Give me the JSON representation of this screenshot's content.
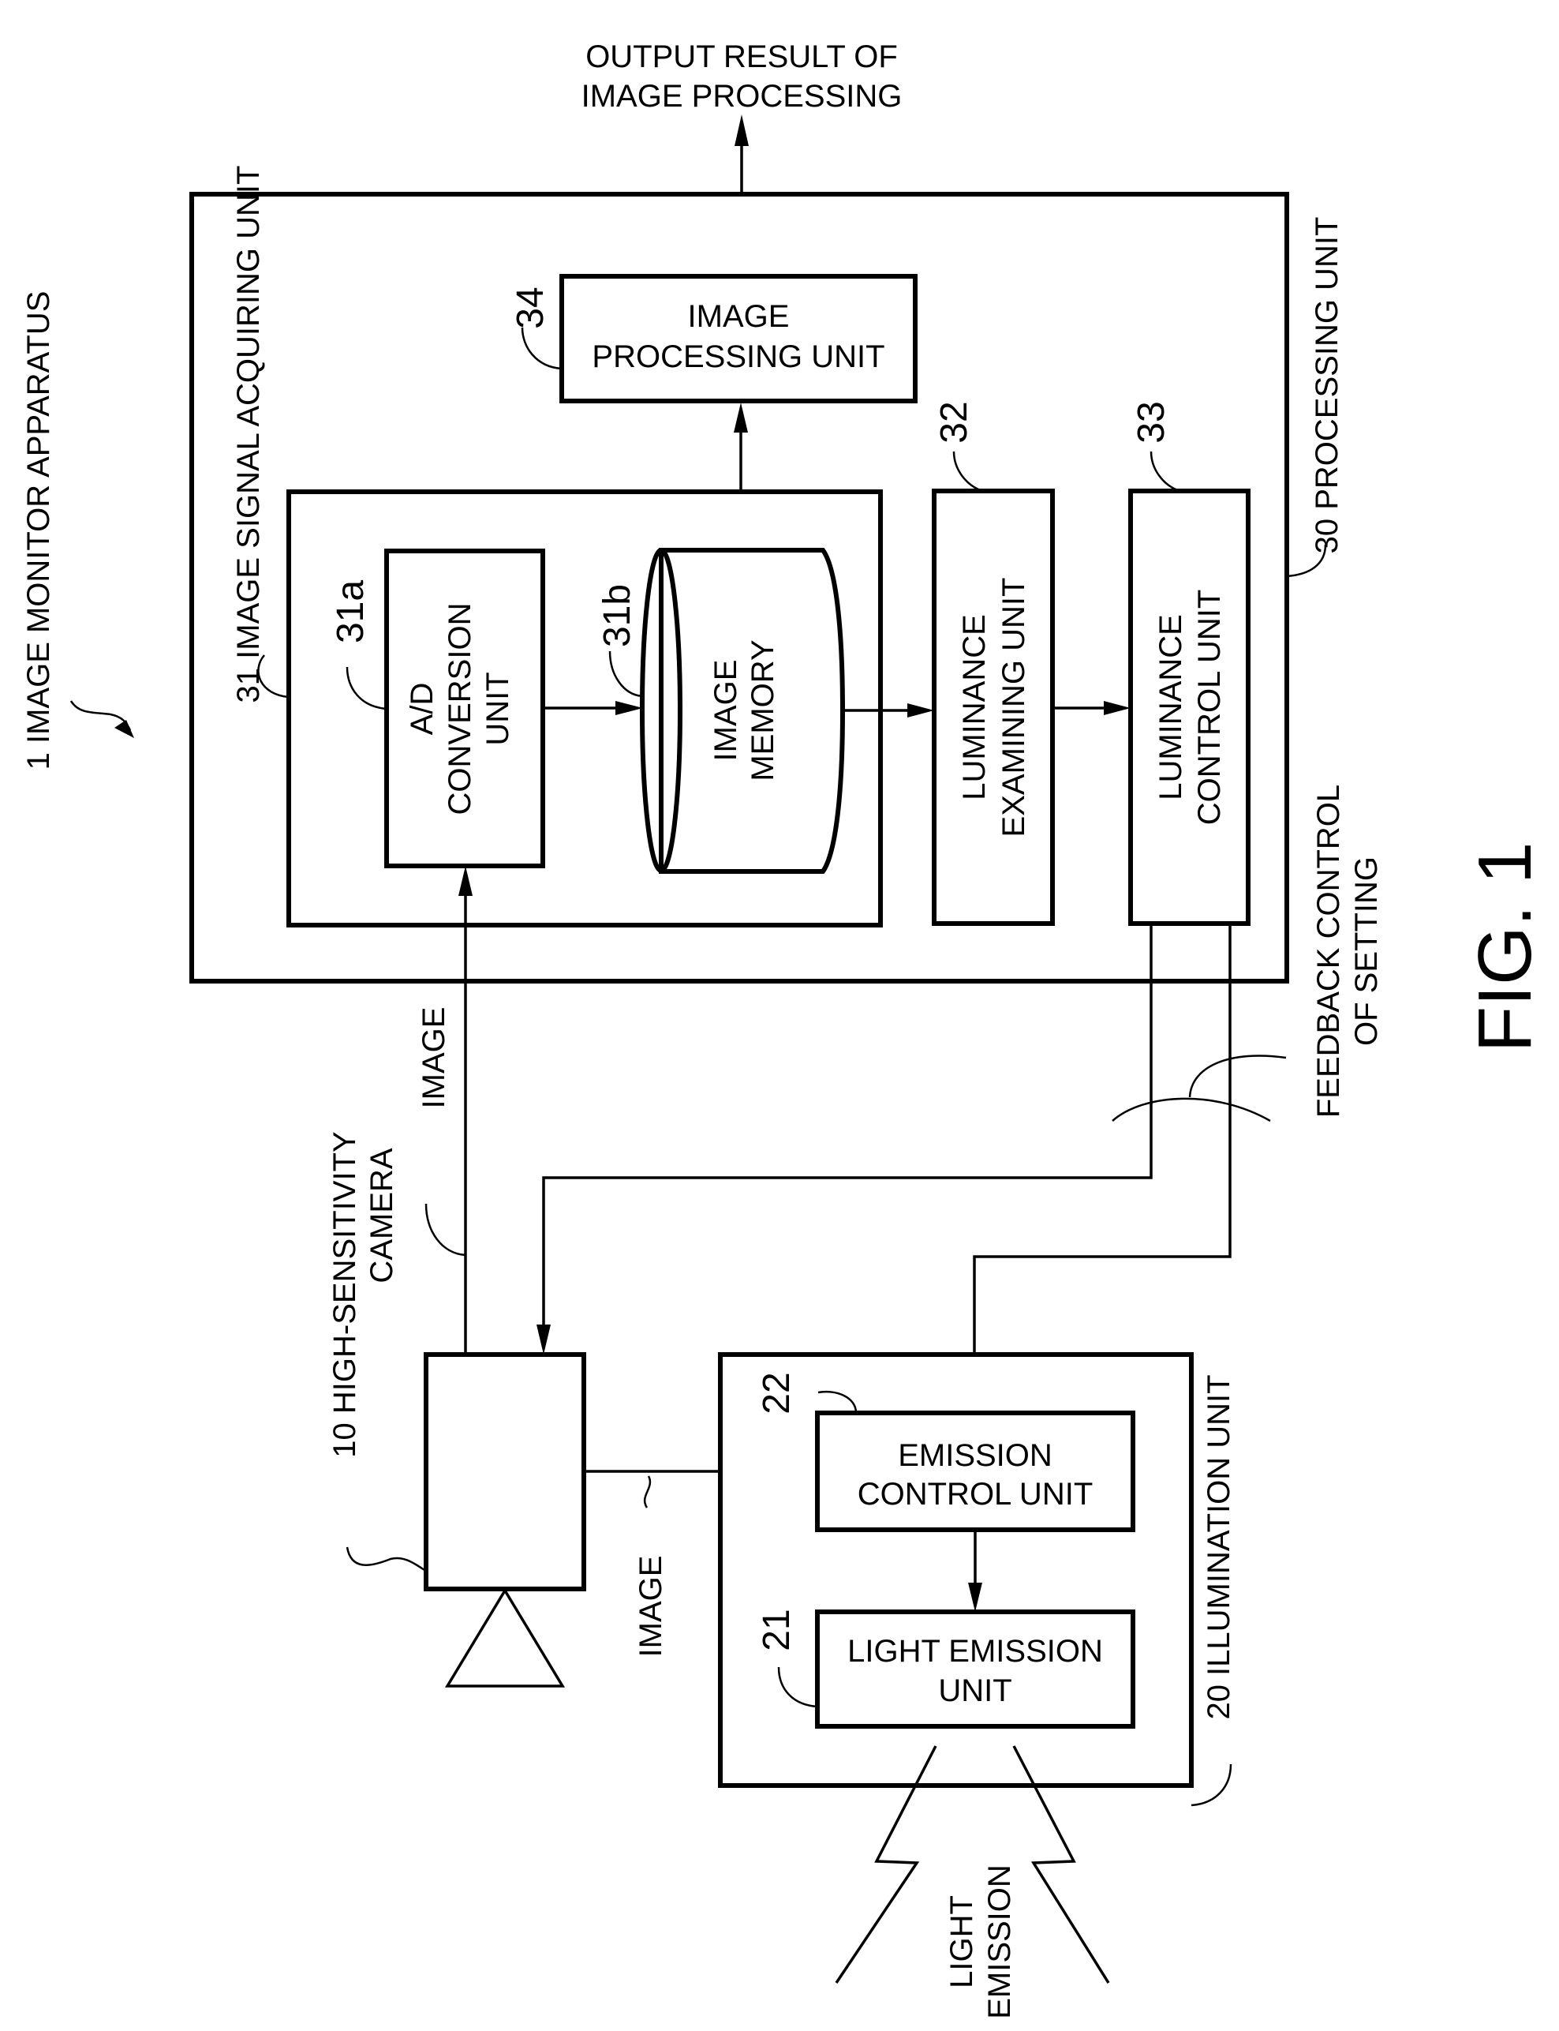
{
  "figure": {
    "caption": "FIG. 1",
    "colors": {
      "ink": "#000000",
      "paper": "#ffffff"
    }
  },
  "labels": {
    "output_line1": "OUTPUT RESULT OF",
    "output_line2": "IMAGE PROCESSING",
    "apparatus": "1  IMAGE MONITOR APPARATUS",
    "signal_acquiring": "31 IMAGE SIGNAL ACQUIRING UNIT",
    "processing_unit": "30  PROCESSING UNIT",
    "image_to_ad": "IMAGE",
    "camera_line1": "10  HIGH-SENSITIVITY",
    "camera_line2": "CAMERA",
    "image_to_emission": "IMAGE",
    "feedback_line1": "FEEDBACK CONTROL",
    "feedback_line2": "OF SETTING",
    "illumination_unit": "20  ILLUMINATION UNIT",
    "light_emission_line1": "LIGHT",
    "light_emission_line2": "EMISSION"
  },
  "blocks": {
    "image_processing": {
      "ref": "34",
      "line1": "IMAGE",
      "line2": "PROCESSING UNIT"
    },
    "ad_conversion": {
      "ref": "31a",
      "line1": "A/D",
      "line2": "CONVERSION",
      "line3": "UNIT"
    },
    "image_memory": {
      "ref": "31b",
      "line1": "IMAGE",
      "line2": "MEMORY"
    },
    "luminance_examining": {
      "ref": "32",
      "line1": "LUMINANCE",
      "line2": "EXAMINING UNIT"
    },
    "luminance_control": {
      "ref": "33",
      "line1": "LUMINANCE",
      "line2": "CONTROL UNIT"
    },
    "emission_control": {
      "ref": "22",
      "line1": "EMISSION",
      "line2": "CONTROL UNIT"
    },
    "light_emission": {
      "ref": "21",
      "line1": "LIGHT EMISSION",
      "line2": "UNIT"
    }
  }
}
